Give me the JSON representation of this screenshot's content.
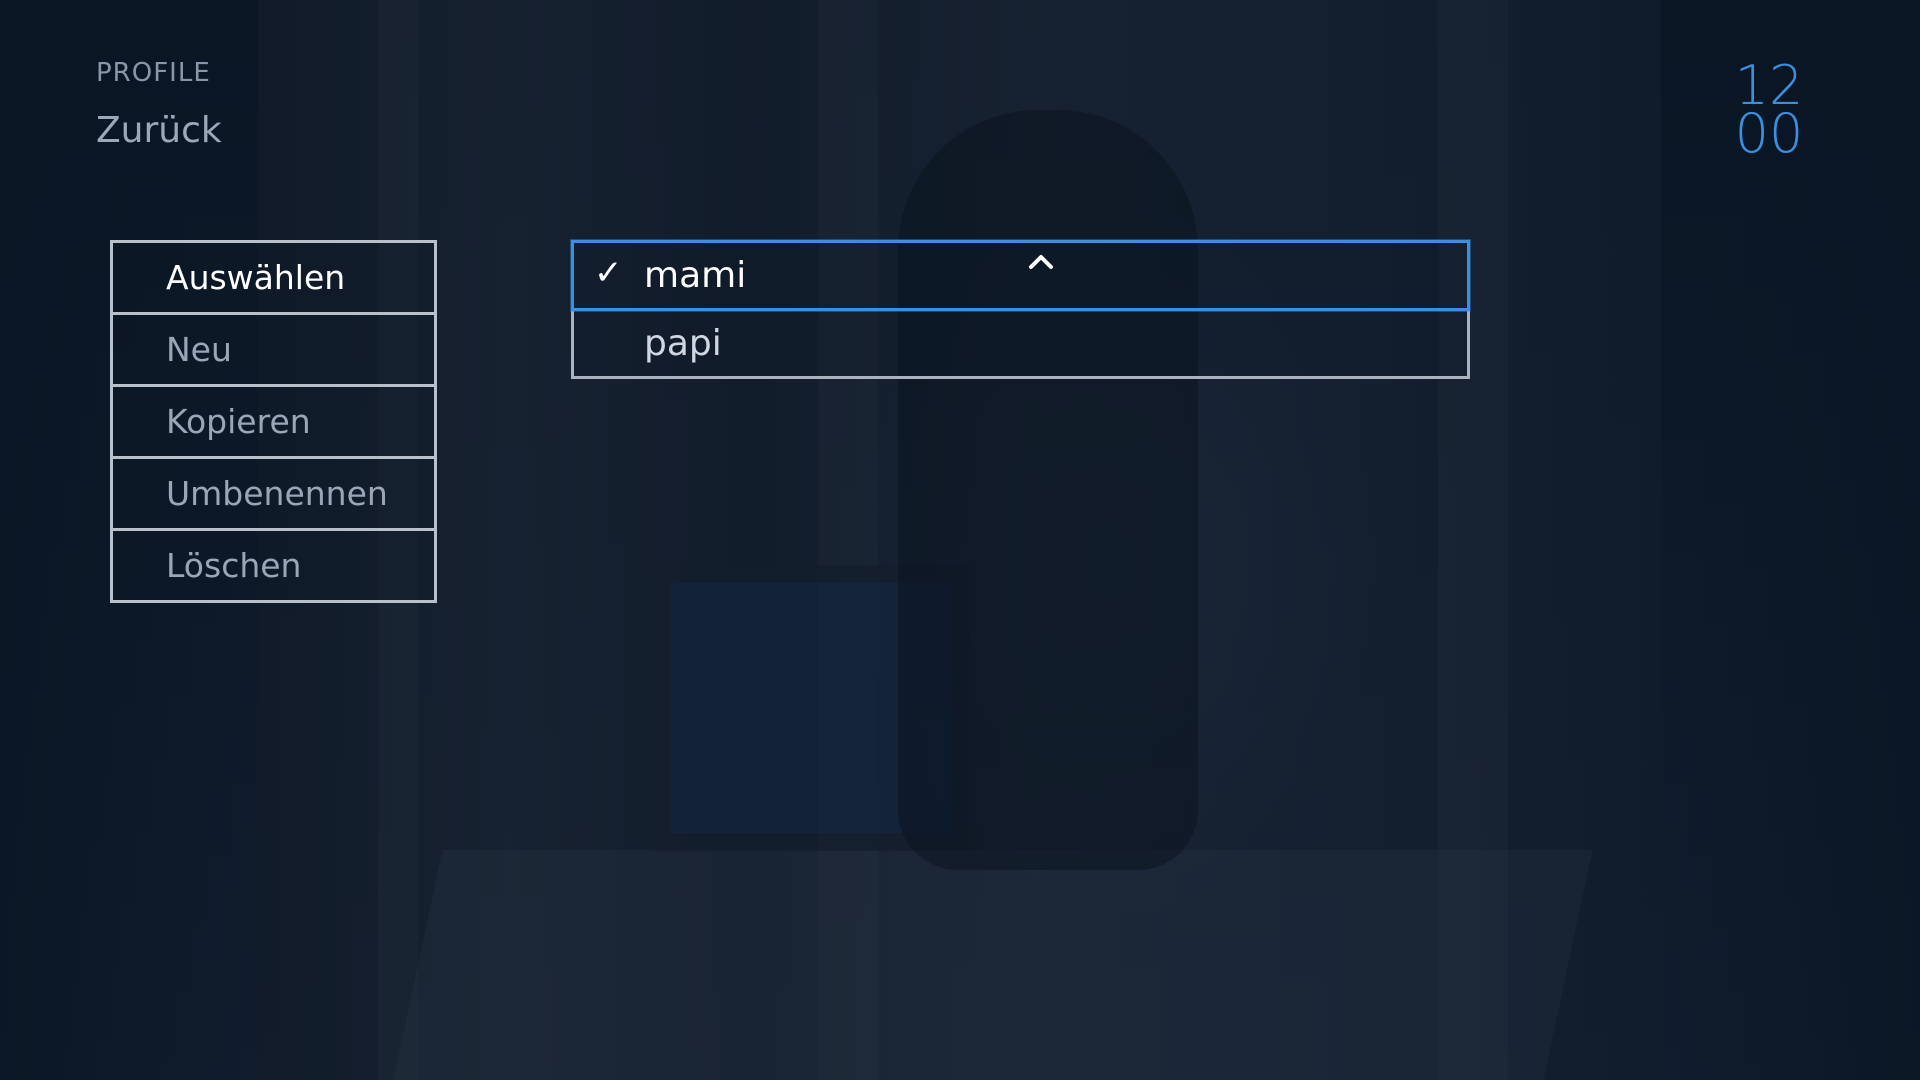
{
  "header": {
    "section": "PROFILE",
    "back_label": "Zurück"
  },
  "clock": {
    "hours": "12",
    "minutes": "00",
    "color": "#3a8fe0"
  },
  "menu": {
    "items": [
      {
        "label": "Auswählen",
        "active": true
      },
      {
        "label": "Neu",
        "active": false
      },
      {
        "label": "Kopieren",
        "active": false
      },
      {
        "label": "Umbenennen",
        "active": false
      },
      {
        "label": "Löschen",
        "active": false
      }
    ]
  },
  "profiles": {
    "items": [
      {
        "name": "mami",
        "checked": true,
        "selected": true
      },
      {
        "name": "papi",
        "checked": false,
        "selected": false
      }
    ],
    "check_icon": "check-icon",
    "scroll_icon": "chevron-up-icon"
  },
  "colors": {
    "accent": "#3a8fe0",
    "border": "#b7c0cb",
    "background": "#0b1a29"
  }
}
